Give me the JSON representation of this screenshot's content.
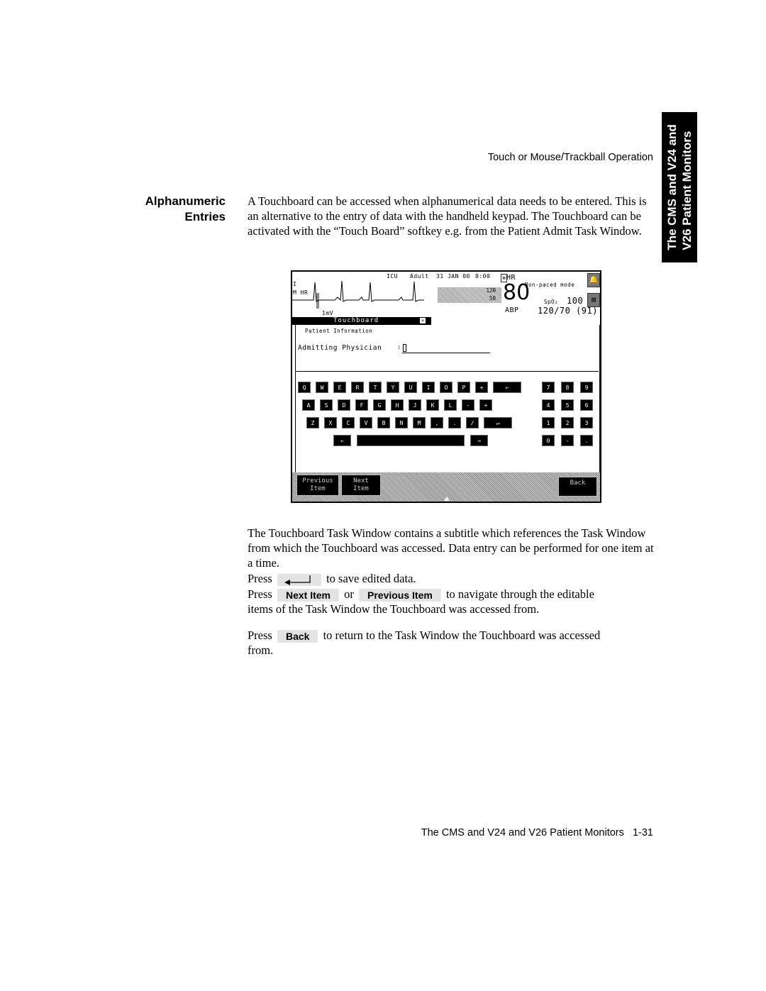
{
  "running_head": "Touch or Mouse/Trackball Operation",
  "side_tab": {
    "line1": "The CMS and V24 and",
    "line2": "V26 Patient Monitors"
  },
  "section": {
    "heading_line1": "Alphanumeric",
    "heading_line2": "Entries",
    "intro": "A Touchboard can be accessed when alphanumerical data needs to be entered. This is an alternative to the entry of data with the handheld keypad. The Touchboard can be activated with the “Touch Board” softkey e.g. from the Patient Admit Task Window."
  },
  "screen": {
    "header": {
      "unit": "ICU",
      "category": "Adult",
      "date": "31 JAN 00",
      "time": "8:00"
    },
    "lead": "I",
    "hr_source": "M HR",
    "scale": "1mV",
    "trend_high": "120",
    "trend_low": "50",
    "hr_label": "HR",
    "hr_value": "80",
    "abp_label": "ABP",
    "pace_mode": "Non-paced mode",
    "spo2_label": "SpO₂",
    "spo2_value": "100",
    "abp_value": "120/70 (91)",
    "touchboard_title": "Touchboard",
    "subtitle": "Patient Information",
    "field_label": "Admitting Physician",
    "field_value": "",
    "keyboard_rows": [
      [
        "Q",
        "W",
        "E",
        "R",
        "T",
        "Y",
        "U",
        "I",
        "O",
        "P",
        "+",
        "←"
      ],
      [
        "A",
        "S",
        "D",
        "F",
        "G",
        "H",
        "J",
        "K",
        "L",
        "-",
        "+"
      ],
      [
        "Z",
        "X",
        "C",
        "V",
        "B",
        "N",
        "M",
        ",",
        ".",
        "/",
        "↵"
      ],
      [
        "←",
        "space",
        "→"
      ]
    ],
    "numpad_rows": [
      [
        "7",
        "8",
        "9"
      ],
      [
        "4",
        "5",
        "6"
      ],
      [
        "1",
        "2",
        "3"
      ],
      [
        "0",
        "-",
        "."
      ]
    ],
    "softkeys": {
      "previous_line1": "Previous",
      "previous_line2": "Item",
      "next_line1": "Next",
      "next_line2": "Item",
      "back": "Back"
    }
  },
  "body": {
    "para2": "The Touchboard Task Window contains a subtitle which references the Task Window from which the Touchboard was accessed. Data entry can be performed for one item at a time.",
    "press": "Press",
    "save_text": "to save edited data.",
    "next_item": "Next Item",
    "or": "or",
    "previous_item": "Previous Item",
    "navigate_text": "to navigate through the editable",
    "navigate_text2": "items of the Task Window the Touchboard was accessed from.",
    "back": "Back",
    "back_text": "to return to the Task Window the Touchboard was accessed",
    "back_text2": "from."
  },
  "footer": {
    "title": "The CMS and V24 and V26 Patient Monitors",
    "page": "1-31"
  }
}
